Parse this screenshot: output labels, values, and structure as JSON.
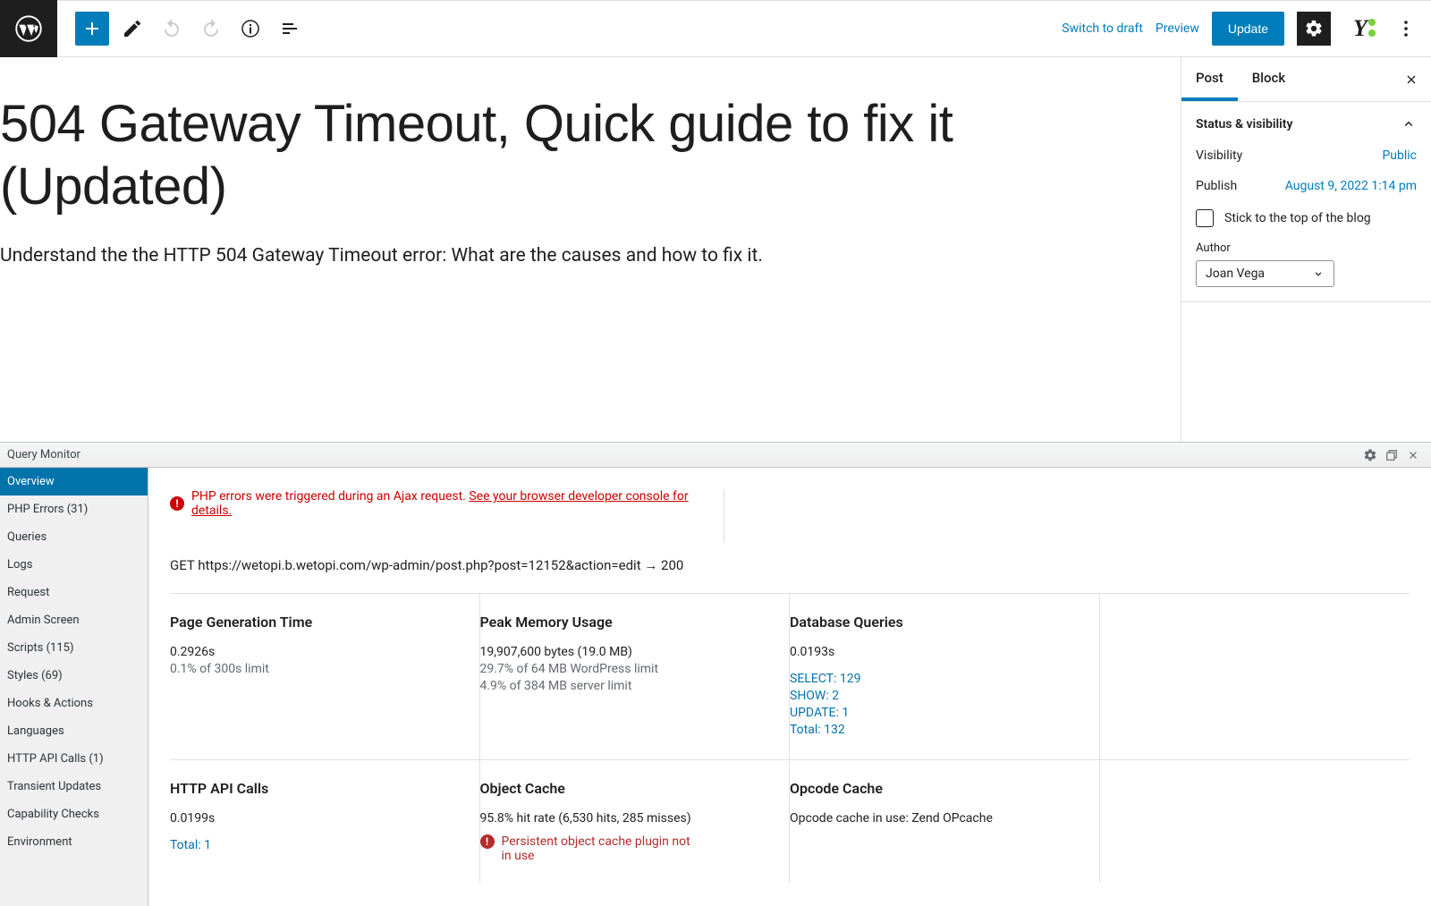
{
  "toolbar": {
    "switch_label": "Switch to draft",
    "preview_label": "Preview",
    "update_label": "Update"
  },
  "post": {
    "title": "504 Gateway Timeout, Quick guide to fix it (Updated)",
    "subtitle": "Understand the the HTTP 504 Gateway Timeout error: What are the causes and how to fix it."
  },
  "inspector": {
    "tab_post": "Post",
    "tab_block": "Block",
    "panel_title": "Status & visibility",
    "visibility_label": "Visibility",
    "visibility_value": "Public",
    "publish_label": "Publish",
    "publish_value": "August 9, 2022 1:14 pm",
    "sticky_label": "Stick to the top of the blog",
    "author_label": "Author",
    "author_value": "Joan Vega"
  },
  "qm": {
    "title": "Query Monitor",
    "nav": [
      "Overview",
      "PHP Errors (31)",
      "Queries",
      "Logs",
      "Request",
      "Admin Screen",
      "Scripts (115)",
      "Styles (69)",
      "Hooks & Actions",
      "Languages",
      "HTTP API Calls (1)",
      "Transient Updates",
      "Capability Checks",
      "Environment"
    ],
    "alert_prefix": "PHP errors were triggered during an Ajax request. ",
    "alert_link": "See your browser developer console for details.",
    "request_line": "GET https://wetopi.b.wetopi.com/wp-admin/post.php?post=12152&action=edit → 200",
    "pagegen": {
      "title": "Page Generation Time",
      "value": "0.2926s",
      "sub": "0.1% of 300s limit"
    },
    "memory": {
      "title": "Peak Memory Usage",
      "value": "19,907,600 bytes (19.0 MB)",
      "sub1": "29.7% of 64 MB WordPress limit",
      "sub2": "4.9% of 384 MB server limit"
    },
    "db": {
      "title": "Database Queries",
      "value": "0.0193s",
      "select": "SELECT: 129",
      "show": "SHOW: 2",
      "update": "UPDATE: 1",
      "total": "Total: 132"
    },
    "http": {
      "title": "HTTP API Calls",
      "value": "0.0199s",
      "total": "Total: 1"
    },
    "objcache": {
      "title": "Object Cache",
      "value": "95.8% hit rate (6,530 hits, 285 misses)",
      "warn": "Persistent object cache plugin not in use"
    },
    "opcache": {
      "title": "Opcode Cache",
      "value": "Opcode cache in use: Zend OPcache"
    }
  }
}
